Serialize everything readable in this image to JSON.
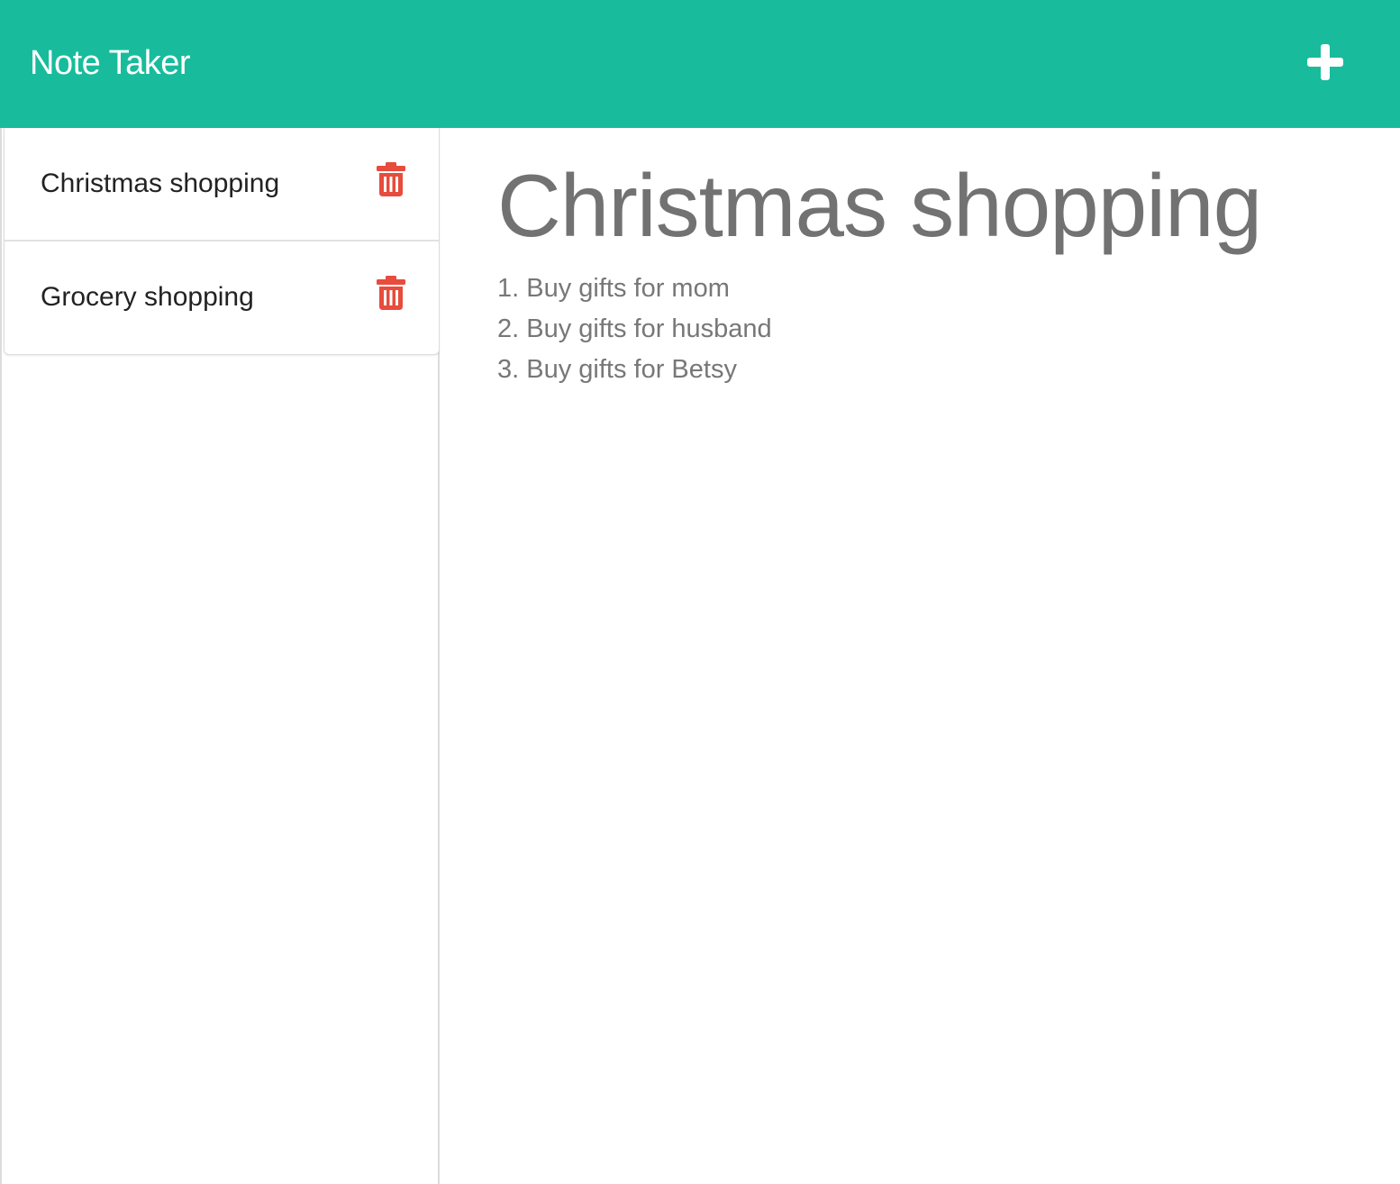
{
  "app": {
    "title": "Note Taker",
    "accent_color": "#18bc9c",
    "delete_color": "#e74c3c"
  },
  "toolbar": {
    "new_note_icon": "plus-icon"
  },
  "sidebar": {
    "notes": [
      {
        "title": "Christmas shopping",
        "delete_icon": "trash-icon"
      },
      {
        "title": "Grocery shopping",
        "delete_icon": "trash-icon"
      }
    ]
  },
  "editor": {
    "title": "Christmas shopping",
    "lines": [
      "1. Buy gifts for mom",
      "2. Buy gifts for husband",
      "3. Buy gifts for Betsy"
    ]
  }
}
